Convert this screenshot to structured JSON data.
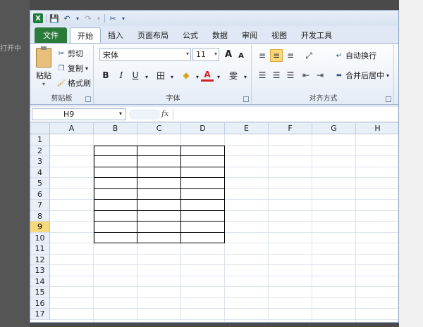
{
  "background": {
    "left_text": "打开中"
  },
  "qat": {
    "app_icon": "X",
    "save": "💾",
    "undo": "↶",
    "undo_drop": "▾",
    "redo": "↷",
    "redo_drop": "▾",
    "tool": "✂",
    "more": "▾"
  },
  "tabs": [
    "文件",
    "开始",
    "插入",
    "页面布局",
    "公式",
    "数据",
    "审阅",
    "视图",
    "开发工具"
  ],
  "ribbon": {
    "clipboard": {
      "paste": "粘贴",
      "cut": "剪切",
      "copy": "复制",
      "format_painter": "格式刷",
      "label": "剪贴板"
    },
    "font": {
      "font_name": "宋体",
      "font_size": "11",
      "grow": "A",
      "shrink": "A",
      "bold": "B",
      "italic": "I",
      "underline": "U",
      "border": "田",
      "fill": "◆",
      "font_color": "A",
      "phonetic": "雯",
      "label": "字体"
    },
    "alignment": {
      "wrap_text": "自动换行",
      "merge_center": "合并后居中",
      "label": "对齐方式"
    }
  },
  "formula_bar": {
    "name_box": "H9",
    "fx": "fx",
    "value": ""
  },
  "sheet": {
    "columns": [
      "A",
      "B",
      "C",
      "D",
      "E",
      "F",
      "G",
      "H"
    ],
    "rows": [
      "1",
      "2",
      "3",
      "4",
      "5",
      "6",
      "7",
      "8",
      "9",
      "10",
      "11",
      "12",
      "13",
      "14",
      "15",
      "16",
      "17"
    ],
    "active_row": "9",
    "bordered_range": "B2:D10"
  },
  "colors": {
    "file_tab": "#2a7a3a",
    "active_row_header": "#f7d87c",
    "align_active": "#fcd878"
  }
}
